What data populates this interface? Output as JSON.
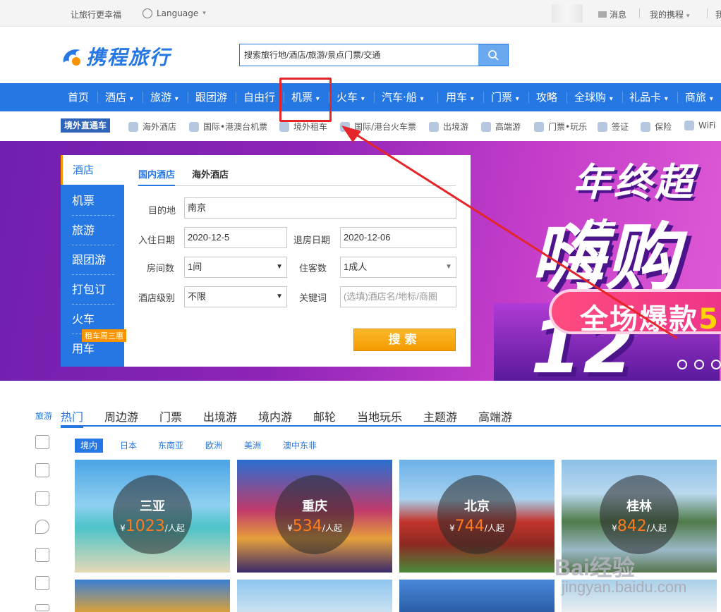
{
  "topbar": {
    "slogan": "让旅行更幸福",
    "language": "Language",
    "messages": "消息",
    "my_trips": "我的携程",
    "me": "我"
  },
  "logo": {
    "text": "携程旅行"
  },
  "search": {
    "placeholder": "搜索旅行地/酒店/旅游/景点门票/交通"
  },
  "nav": {
    "items": [
      {
        "label": "首页",
        "caret": ""
      },
      {
        "label": "酒店",
        "caret": "▾"
      },
      {
        "label": "旅游",
        "caret": "▾"
      },
      {
        "label": "跟团游",
        "caret": ""
      },
      {
        "label": "自由行",
        "caret": ""
      },
      {
        "label": "机票",
        "caret": "▾"
      },
      {
        "label": "火车",
        "caret": "▾"
      },
      {
        "label": "汽车·船",
        "caret": "▾"
      },
      {
        "label": "用车",
        "caret": "▾"
      },
      {
        "label": "门票",
        "caret": "▾"
      },
      {
        "label": "攻略",
        "caret": ""
      },
      {
        "label": "全球购",
        "caret": "▾"
      },
      {
        "label": "礼品卡",
        "caret": "▾"
      },
      {
        "label": "商旅",
        "caret": "▾"
      }
    ]
  },
  "subnav": {
    "tag": "境外直通车",
    "items": [
      "海外酒店",
      "国际•港澳台机票",
      "境外租车",
      "国际/港台火车票",
      "出境游",
      "高端游",
      "门票•玩乐",
      "签证",
      "保险",
      "WiFi"
    ]
  },
  "banner": {
    "line1": "年终超值",
    "line2": "嗨购12",
    "line3_a": "全场爆款",
    "line3_b": "5"
  },
  "side": {
    "items": [
      "酒店",
      "机票",
      "旅游",
      "跟团游",
      "打包订",
      "火车",
      "用车"
    ],
    "badge": "租车周三惠"
  },
  "hotel_form": {
    "tabs": [
      "国内酒店",
      "海外酒店"
    ],
    "dest_label": "目的地",
    "dest_value": "南京",
    "checkin_label": "入住日期",
    "checkin_value": "2020-12-5",
    "checkout_label": "退房日期",
    "checkout_value": "2020-12-06",
    "rooms_label": "房间数",
    "rooms_value": "1间",
    "guests_label": "住客数",
    "guests_value": "1成人",
    "level_label": "酒店级别",
    "level_value": "不限",
    "keyword_label": "关键词",
    "keyword_placeholder": "(选填)酒店名/地标/商圈",
    "search_button": "搜索"
  },
  "left_strip": {
    "label": "旅游"
  },
  "categories": [
    "热门",
    "周边游",
    "门票",
    "出境游",
    "境内游",
    "邮轮",
    "当地玩乐",
    "主题游",
    "高端游"
  ],
  "regions": [
    "境内",
    "日本",
    "东南亚",
    "欧洲",
    "美洲",
    "澳中东非"
  ],
  "destinations": [
    {
      "name": "三亚",
      "currency": "¥",
      "price": "1023",
      "unit": "/人起"
    },
    {
      "name": "重庆",
      "currency": "¥",
      "price": "534",
      "unit": "/人起"
    },
    {
      "name": "北京",
      "currency": "¥",
      "price": "744",
      "unit": "/人起"
    },
    {
      "name": "桂林",
      "currency": "¥",
      "price": "842",
      "unit": "/人起"
    }
  ],
  "watermark": {
    "line1": "Bai经验",
    "line2": "jingyan.baidu.com"
  },
  "colors": {
    "brand": "#2577e3",
    "accent": "#f79400",
    "highlight": "#e5252a"
  }
}
